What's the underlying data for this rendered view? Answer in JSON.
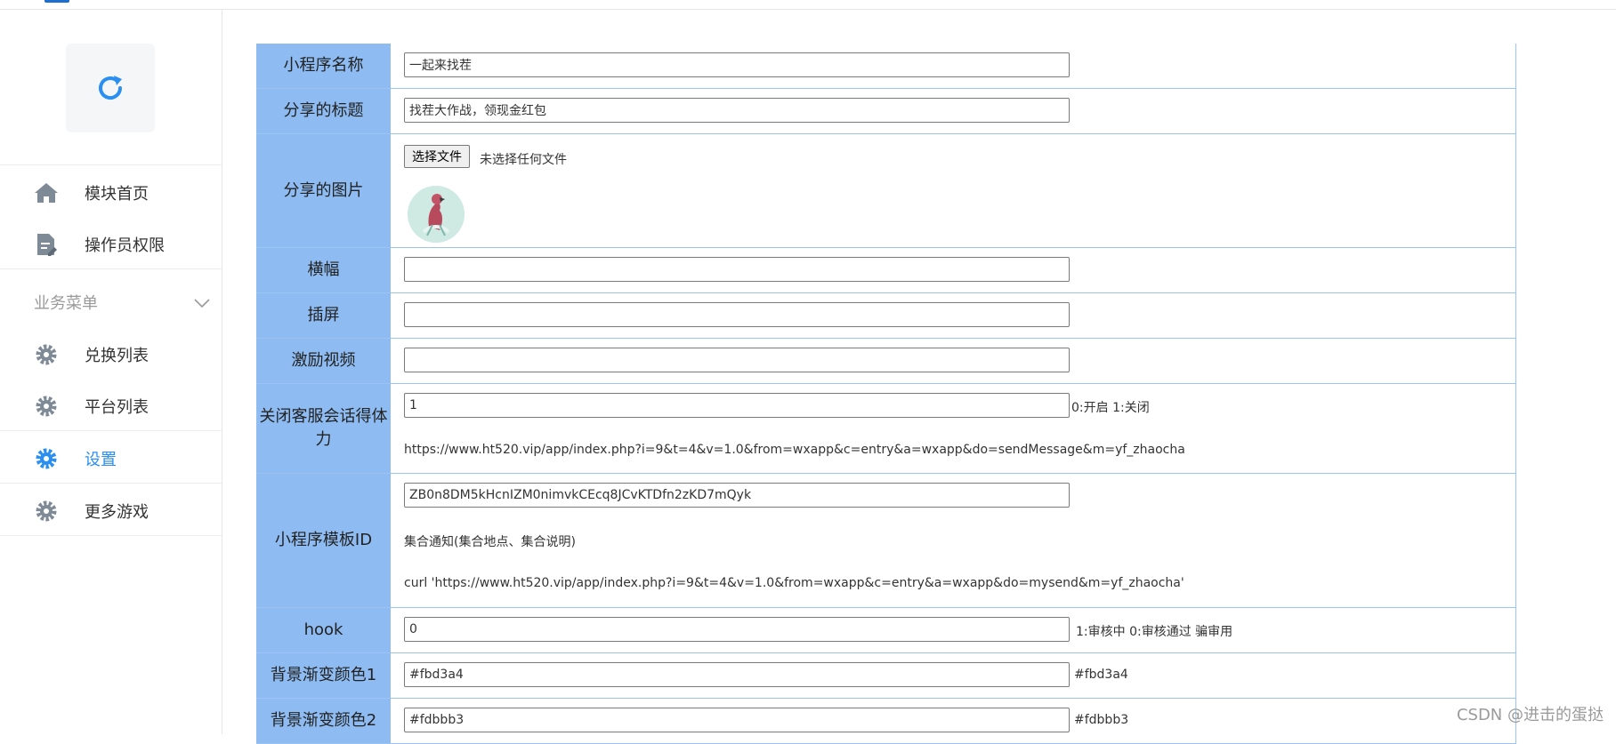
{
  "sidebar": {
    "logo_icon": "refresh-icon",
    "top_items": [
      {
        "label": "模块首页",
        "icon": "home-icon"
      },
      {
        "label": "操作员权限",
        "icon": "document-edit-icon"
      }
    ],
    "section_title": "业务菜单",
    "section_items": [
      {
        "label": "兑换列表",
        "icon": "gear-icon"
      },
      {
        "label": "平台列表",
        "icon": "gear-icon"
      },
      {
        "label": "设置",
        "icon": "gear-icon",
        "active": true
      },
      {
        "label": "更多游戏",
        "icon": "gear-icon"
      }
    ],
    "accent_color": "#2a8ff0"
  },
  "form": {
    "label_bg": "#8ebcf2",
    "rows": {
      "app_name": {
        "label": "小程序名称",
        "value": "一起来找茬"
      },
      "share_title": {
        "label": "分享的标题",
        "value": "找茬大作战，领现金红包"
      },
      "share_image": {
        "label": "分享的图片",
        "button": "选择文件",
        "status": "未选择任何文件"
      },
      "banner": {
        "label": "横幅",
        "value": ""
      },
      "interstitial": {
        "label": "插屏",
        "value": ""
      },
      "reward_video": {
        "label": "激励视频",
        "value": ""
      },
      "close_service": {
        "label": "关闭客服会话得体力",
        "value": "1",
        "hint": "0:开启 1:关闭",
        "url": "https://www.ht520.vip/app/index.php?i=9&t=4&v=1.0&from=wxapp&c=entry&a=wxapp&do=sendMessage&m=yf_zhaocha"
      },
      "template_id": {
        "label": "小程序模板ID",
        "value": "ZB0n8DM5kHcnIZM0nimvkCEcq8JCvKTDfn2zKD7mQyk",
        "note": "集合通知(集合地点、集合说明)",
        "curl": "curl 'https://www.ht520.vip/app/index.php?i=9&t=4&v=1.0&from=wxapp&c=entry&a=wxapp&do=mysend&m=yf_zhaocha'"
      },
      "hook": {
        "label": "hook",
        "value": "0",
        "hint": "1:审核中 0:审核通过 骗审用"
      },
      "bg_color1": {
        "label": "背景渐变颜色1",
        "value": "#fbd3a4",
        "hint": "#fbd3a4"
      },
      "bg_color2": {
        "label": "背景渐变颜色2",
        "value": "#fdbbb3",
        "hint": "#fdbbb3"
      }
    }
  },
  "watermark": "CSDN @进击的蛋挞"
}
